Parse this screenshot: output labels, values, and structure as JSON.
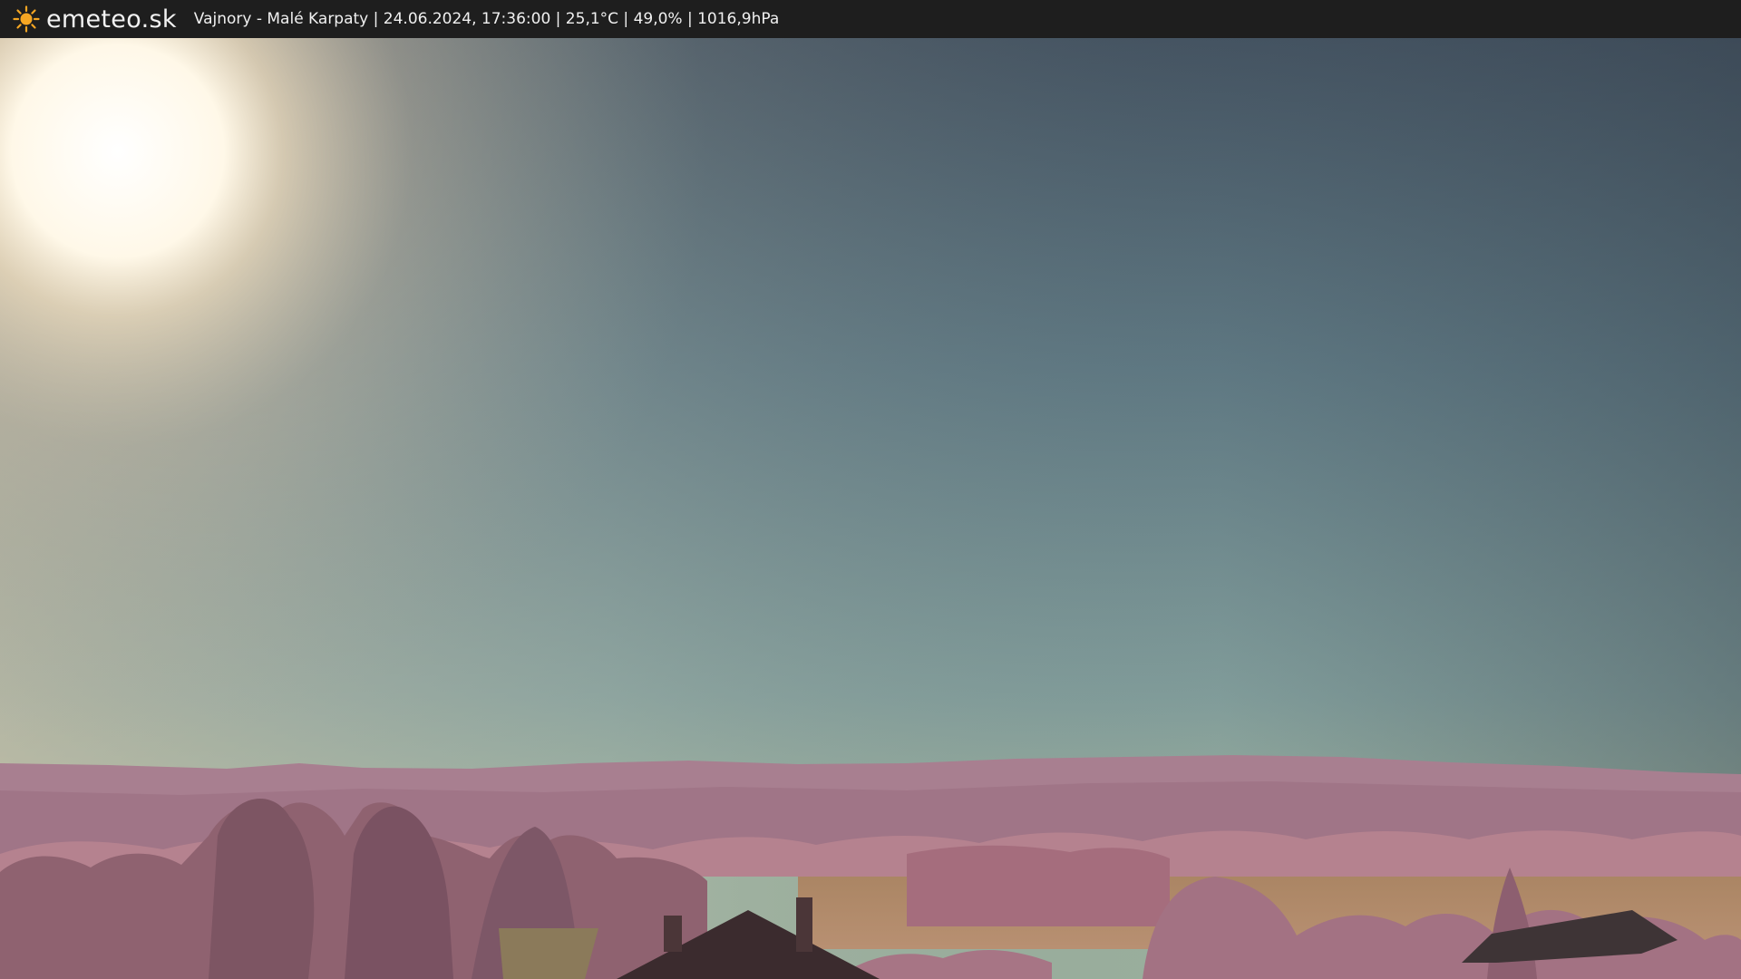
{
  "header": {
    "brand_icon": "sun-icon",
    "brand": "emeteo.sk",
    "caption": "Vajnory - Malé Karpaty | 24.06.2024, 17:36:00 | 25,1°C | 49,0% | 1016,9hPa"
  },
  "colors": {
    "bar": "#1e1e1e",
    "sun_icon": "#f5a623",
    "sky_top": "#3f4e5c",
    "sky_horizon": "#9fb3a2",
    "vegetation": "#b07d8d"
  }
}
